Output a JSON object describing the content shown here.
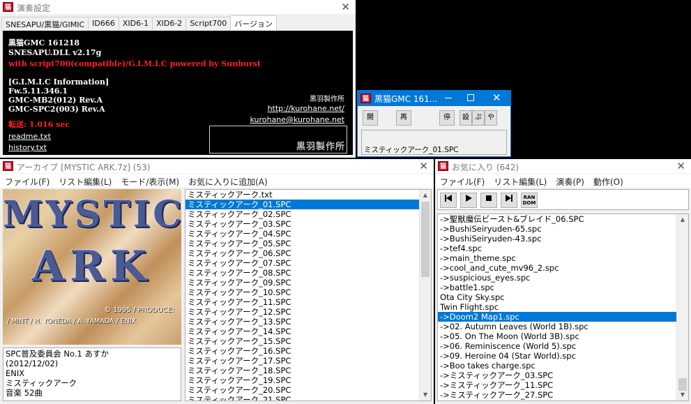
{
  "settings_window": {
    "title": "演奏設定",
    "tabs": [
      "SNESAPU/黒猫/GIMIC",
      "ID666",
      "XID6-1",
      "XID6-2",
      "Script700",
      "バージョン"
    ],
    "lines": {
      "app_version": "黒猫GMC 161218",
      "dll_version": "SNESAPU.DLL v2.17g",
      "powered": "with script700(compatible)/G.I.M.I.C powered by Sunburst",
      "gimic_header": "[G.I.M.I.C Information]",
      "fw": "Fw.5.11.346.1",
      "mb2": "GMC-MB2(012) Rev.A",
      "spc2": "GMC-SPC2(003) Rev.A",
      "transfer": "転送: 1.016 sec"
    },
    "links": {
      "readme": "readme.txt",
      "history": "history.txt",
      "url": "http://kurohane.net/",
      "email": "kurohane@kurohane.net"
    },
    "maker_label": "黒羽製作所",
    "logo_text": "黒羽製作所",
    "colors": {
      "red_text": "#ff2020",
      "bg": "#000000"
    }
  },
  "mini_player": {
    "title": "黒猫GMC 161...",
    "buttons": {
      "open": "開",
      "play": "再",
      "stop": "停",
      "settings": "設",
      "favorite": "ぷ",
      "next": "や"
    },
    "now_playing": "ミスティックアーク_01.SPC",
    "accent": "#0078d7"
  },
  "archive_window": {
    "title": "アーカイブ [MYSTIC ARK.7z] (53)",
    "menu": [
      "ファイル(F)",
      "リスト編集(L)",
      "モード/表示(M)",
      "お気に入りに追加(A)"
    ],
    "cover": {
      "title_line1": "MYSTIC",
      "title_line2": "ARK",
      "credit1": "© 1995 / PRODUCE:",
      "credit2": "/ MINT / H. YONEDA / A. YAMADA / ENIX"
    },
    "info": [
      "SPC普及委員会 No.1 あすか",
      "(2012/12/02)",
      "ENIX",
      "ミスティックアーク",
      "音楽 52曲"
    ],
    "files": [
      "ミスティックアーク.txt",
      "ミスティックアーク_01.SPC",
      "ミスティックアーク_02.SPC",
      "ミスティックアーク_03.SPC",
      "ミスティックアーク_04.SPC",
      "ミスティックアーク_05.SPC",
      "ミスティックアーク_06.SPC",
      "ミスティックアーク_07.SPC",
      "ミスティックアーク_08.SPC",
      "ミスティックアーク_09.SPC",
      "ミスティックアーク_10.SPC",
      "ミスティックアーク_11.SPC",
      "ミスティックアーク_12.SPC",
      "ミスティックアーク_13.SPC",
      "ミスティックアーク_14.SPC",
      "ミスティックアーク_15.SPC",
      "ミスティックアーク_16.SPC",
      "ミスティックアーク_17.SPC",
      "ミスティックアーク_18.SPC",
      "ミスティックアーク_19.SPC",
      "ミスティックアーク_20.SPC",
      "ミスティックアーク_21.SPC"
    ],
    "selected_index": 1
  },
  "favorites_window": {
    "title": "お気に入り (642)",
    "menu": [
      "ファイル(F)",
      "リスト編集(L)",
      "演奏(P)",
      "動作(O)"
    ],
    "toolbar": [
      "prev-icon",
      "play-icon",
      "stop-icon",
      "next-icon",
      "random-icon"
    ],
    "random_label": "RAN DOM",
    "items": [
      "->聖獣魔伝ビースト&ブレイド_06.SPC",
      "->BushiSeiryuden-65.spc",
      "->BushiSeiryuden-43.spc",
      "->tef4.spc",
      "->main_theme.spc",
      "->cool_and_cute_mv96_2.spc",
      "->suspicious_eyes.spc",
      "->battle1.spc",
      "Ota City Sky.spc",
      "Twin Flight.spc",
      "->Doom2 Map1.spc",
      "->02. Autumn Leaves (World 1B).spc",
      "->05. On The Moon (World 3B).spc",
      "->06. Reminiscence (World 5).spc",
      "->09. Heroine 04 (Star World).spc",
      "->Boo takes charge.spc",
      "->ミスティックアーク_03.SPC",
      "->ミスティックアーク_11.SPC",
      "->ミスティックアーク_27.SPC"
    ],
    "selected_index": 10
  }
}
